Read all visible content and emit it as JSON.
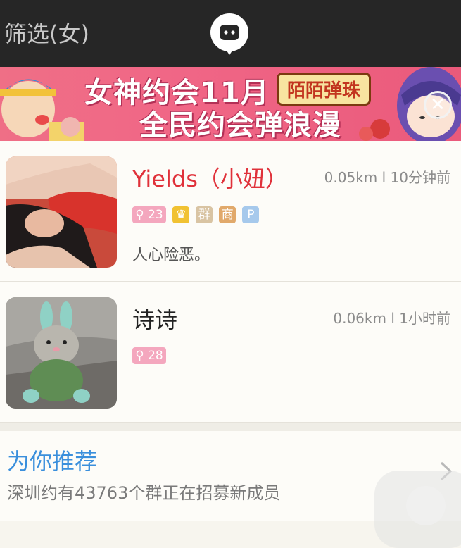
{
  "header": {
    "filter_label": "筛选(女)",
    "logo_icon": "momo-chat-bubble-icon"
  },
  "banner": {
    "line1": "女神约会11月",
    "line2": "全民约会弹浪漫",
    "brand_logo": "陌陌弹珠",
    "close_icon": "close-circle-icon",
    "close_glyph": "✕"
  },
  "users": [
    {
      "name": "Yields（小妞）",
      "name_color": "#e0313a",
      "distance": "0.05km",
      "separator": "l",
      "time": "10分钟前",
      "age": "23",
      "gender_icon": "female-symbol-icon",
      "badges": [
        {
          "icon": "crown-icon",
          "color": "#f1c232"
        },
        {
          "text": "群",
          "color": "#d9c4a3"
        },
        {
          "text": "商",
          "color": "#e1a96b"
        },
        {
          "text": "P",
          "color": "#a6c9ec"
        }
      ],
      "signature": "人心险恶。"
    },
    {
      "name": "诗诗",
      "name_color": "#222222",
      "distance": "0.06km",
      "separator": "l",
      "time": "1小时前",
      "age": "28",
      "gender_icon": "female-symbol-icon",
      "badges": [],
      "signature": ""
    }
  ],
  "recommend": {
    "title": "为你推荐",
    "description": "深圳约有43763个群正在招募新成员",
    "arrow_icon": "chevron-right-icon"
  },
  "colors": {
    "topbar": "#262626",
    "banner_pink": "#ef6f86",
    "accent_blue": "#3a8fdc",
    "age_tag_pink": "#f4a7be"
  }
}
